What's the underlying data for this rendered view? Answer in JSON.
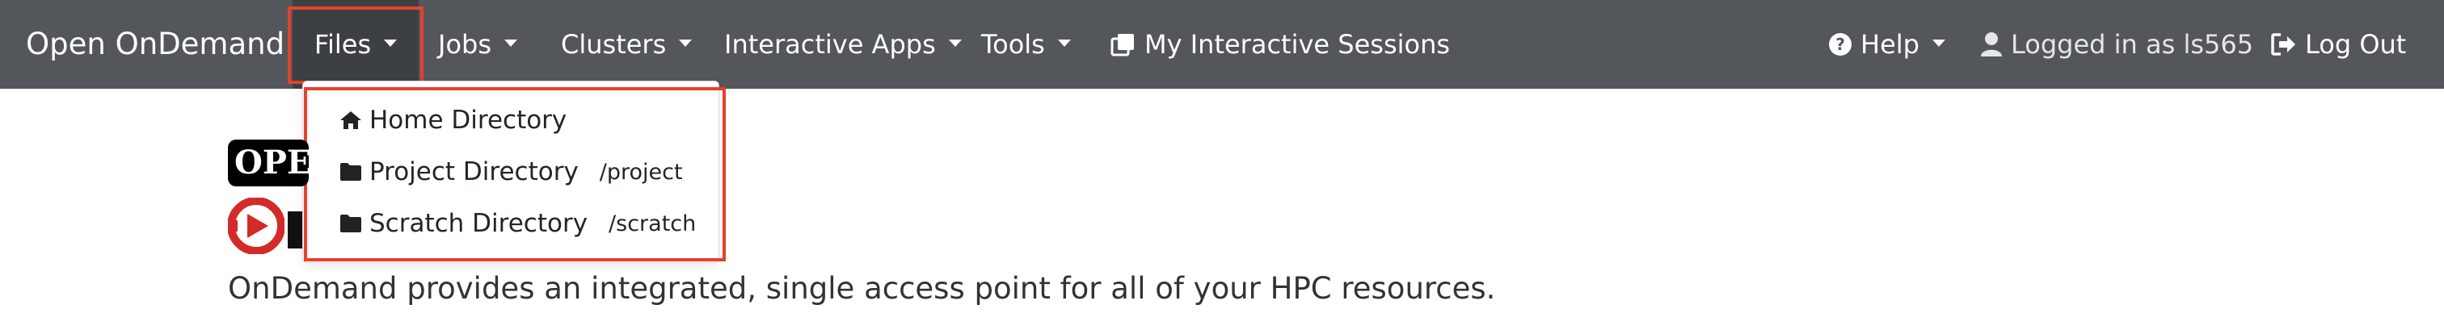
{
  "navbar": {
    "brand": "Open OnDemand",
    "files": "Files",
    "jobs": "Jobs",
    "clusters": "Clusters",
    "interactive_apps": "Interactive Apps",
    "tools": "Tools",
    "my_sessions": "My Interactive Sessions",
    "help": "Help",
    "logged_in": "Logged in as ls565",
    "logout": "Log Out"
  },
  "files_menu": {
    "items": [
      {
        "label": "Home Directory",
        "path": "",
        "icon": "home-icon"
      },
      {
        "label": "Project Directory",
        "path": "/project",
        "icon": "folder-icon"
      },
      {
        "label": "Scratch Directory",
        "path": "/scratch",
        "icon": "folder-icon"
      }
    ]
  },
  "main": {
    "logo_text": "OPEN",
    "tagline": "OnDemand provides an integrated, single access point for all of your HPC resources."
  },
  "colors": {
    "navbar_bg": "#53565a",
    "highlight": "#e5412d",
    "logo_red": "#d32a2a"
  }
}
